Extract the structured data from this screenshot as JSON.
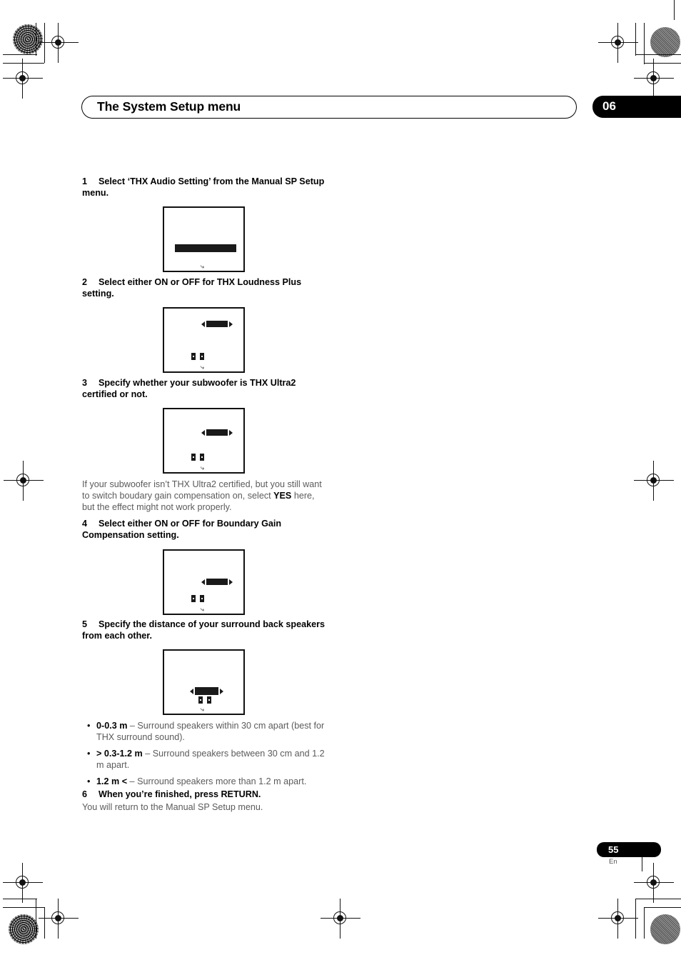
{
  "header": {
    "title": "The System Setup menu",
    "chapter": "06"
  },
  "steps": [
    {
      "num": "1",
      "text": "Select ‘THX Audio Setting’ from the Manual SP Setup menu."
    },
    {
      "num": "2",
      "text": "Select either ON or OFF for THX Loudness Plus setting."
    },
    {
      "num": "3",
      "text": "Specify whether your subwoofer is THX Ultra2 certified or not."
    },
    {
      "num": "4",
      "text": "Select either ON or OFF for Boundary Gain Compensation setting."
    },
    {
      "num": "5",
      "text": "Specify the distance of your surround back speakers from each other."
    },
    {
      "num": "6",
      "text": "When you’re finished, press RETURN."
    }
  ],
  "note": {
    "part1": "If your subwoofer isn’t THX Ultra2 certified, but you still want to switch boudary gain compensation on, select ",
    "emphasis": "YES",
    "part2": " here, but the effect might not work properly."
  },
  "bullets": [
    {
      "term": "0-0.3 m",
      "desc": " – Surround speakers within 30 cm apart (best for THX surround sound)."
    },
    {
      "term": "> 0.3-1.2 m",
      "desc": " – Surround speakers between 30 cm and 1.2 m apart."
    },
    {
      "term": "1.2 m <",
      "desc": " – Surround speakers more than 1.2 m apart."
    }
  ],
  "closing": "You will return to the Manual SP Setup menu.",
  "osd_screens": [
    {
      "name": "thx-audio-setting-menu",
      "return_icon": "return-arrow-icon"
    },
    {
      "name": "thx-loudness-plus-setting",
      "return_icon": "return-arrow-icon"
    },
    {
      "name": "subwoofer-thx-ultra2-setting",
      "return_icon": "return-arrow-icon"
    },
    {
      "name": "boundary-gain-compensation-setting",
      "return_icon": "return-arrow-icon"
    },
    {
      "name": "surround-back-speaker-distance-setting",
      "return_icon": "return-arrow-icon"
    }
  ],
  "footer": {
    "page_number": "55",
    "language": "En"
  },
  "colors": {
    "ink": "#000000",
    "body_text": "#5b5b5b",
    "osd_fill": "#1a1a1a"
  }
}
